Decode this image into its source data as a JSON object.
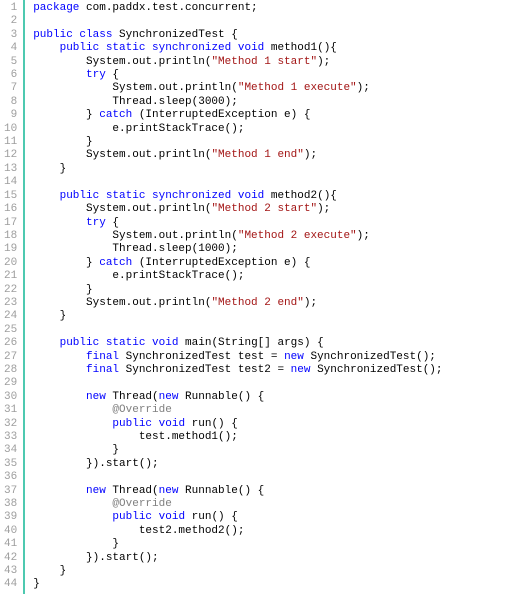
{
  "gutter": " 1\n 2\n 3\n 4\n 5\n 6\n 7\n 8\n 9\n10\n11\n12\n13\n14\n15\n16\n17\n18\n19\n20\n21\n22\n23\n24\n25\n26\n27\n28\n29\n30\n31\n32\n33\n34\n35\n36\n37\n38\n39\n40\n41\n42\n43\n44",
  "lines": [
    [
      {
        "cls": "kw",
        "t": "package"
      },
      {
        "cls": "",
        "t": " com.paddx.test.concurrent;"
      }
    ],
    [
      {
        "cls": "",
        "t": ""
      }
    ],
    [
      {
        "cls": "kw",
        "t": "public"
      },
      {
        "cls": "",
        "t": " "
      },
      {
        "cls": "kw",
        "t": "class"
      },
      {
        "cls": "",
        "t": " SynchronizedTest {"
      }
    ],
    [
      {
        "cls": "",
        "t": "    "
      },
      {
        "cls": "kw",
        "t": "public"
      },
      {
        "cls": "",
        "t": " "
      },
      {
        "cls": "kw",
        "t": "static"
      },
      {
        "cls": "",
        "t": " "
      },
      {
        "cls": "kw",
        "t": "synchronized"
      },
      {
        "cls": "",
        "t": " "
      },
      {
        "cls": "kw",
        "t": "void"
      },
      {
        "cls": "",
        "t": " method1(){"
      }
    ],
    [
      {
        "cls": "",
        "t": "        System.out.println("
      },
      {
        "cls": "str",
        "t": "\"Method 1 start\""
      },
      {
        "cls": "",
        "t": ");"
      }
    ],
    [
      {
        "cls": "",
        "t": "        "
      },
      {
        "cls": "kw",
        "t": "try"
      },
      {
        "cls": "",
        "t": " {"
      }
    ],
    [
      {
        "cls": "",
        "t": "            System.out.println("
      },
      {
        "cls": "str",
        "t": "\"Method 1 execute\""
      },
      {
        "cls": "",
        "t": ");"
      }
    ],
    [
      {
        "cls": "",
        "t": "            Thread.sleep(3000);"
      }
    ],
    [
      {
        "cls": "",
        "t": "        } "
      },
      {
        "cls": "kw",
        "t": "catch"
      },
      {
        "cls": "",
        "t": " (InterruptedException e) {"
      }
    ],
    [
      {
        "cls": "",
        "t": "            e.printStackTrace();"
      }
    ],
    [
      {
        "cls": "",
        "t": "        }"
      }
    ],
    [
      {
        "cls": "",
        "t": "        System.out.println("
      },
      {
        "cls": "str",
        "t": "\"Method 1 end\""
      },
      {
        "cls": "",
        "t": ");"
      }
    ],
    [
      {
        "cls": "",
        "t": "    }"
      }
    ],
    [
      {
        "cls": "",
        "t": ""
      }
    ],
    [
      {
        "cls": "",
        "t": "    "
      },
      {
        "cls": "kw",
        "t": "public"
      },
      {
        "cls": "",
        "t": " "
      },
      {
        "cls": "kw",
        "t": "static"
      },
      {
        "cls": "",
        "t": " "
      },
      {
        "cls": "kw",
        "t": "synchronized"
      },
      {
        "cls": "",
        "t": " "
      },
      {
        "cls": "kw",
        "t": "void"
      },
      {
        "cls": "",
        "t": " method2(){"
      }
    ],
    [
      {
        "cls": "",
        "t": "        System.out.println("
      },
      {
        "cls": "str",
        "t": "\"Method 2 start\""
      },
      {
        "cls": "",
        "t": ");"
      }
    ],
    [
      {
        "cls": "",
        "t": "        "
      },
      {
        "cls": "kw",
        "t": "try"
      },
      {
        "cls": "",
        "t": " {"
      }
    ],
    [
      {
        "cls": "",
        "t": "            System.out.println("
      },
      {
        "cls": "str",
        "t": "\"Method 2 execute\""
      },
      {
        "cls": "",
        "t": ");"
      }
    ],
    [
      {
        "cls": "",
        "t": "            Thread.sleep(1000);"
      }
    ],
    [
      {
        "cls": "",
        "t": "        } "
      },
      {
        "cls": "kw",
        "t": "catch"
      },
      {
        "cls": "",
        "t": " (InterruptedException e) {"
      }
    ],
    [
      {
        "cls": "",
        "t": "            e.printStackTrace();"
      }
    ],
    [
      {
        "cls": "",
        "t": "        }"
      }
    ],
    [
      {
        "cls": "",
        "t": "        System.out.println("
      },
      {
        "cls": "str",
        "t": "\"Method 2 end\""
      },
      {
        "cls": "",
        "t": ");"
      }
    ],
    [
      {
        "cls": "",
        "t": "    }"
      }
    ],
    [
      {
        "cls": "",
        "t": ""
      }
    ],
    [
      {
        "cls": "",
        "t": "    "
      },
      {
        "cls": "kw",
        "t": "public"
      },
      {
        "cls": "",
        "t": " "
      },
      {
        "cls": "kw",
        "t": "static"
      },
      {
        "cls": "",
        "t": " "
      },
      {
        "cls": "kw",
        "t": "void"
      },
      {
        "cls": "",
        "t": " main(String[] args) {"
      }
    ],
    [
      {
        "cls": "",
        "t": "        "
      },
      {
        "cls": "kw",
        "t": "final"
      },
      {
        "cls": "",
        "t": " SynchronizedTest test = "
      },
      {
        "cls": "kw",
        "t": "new"
      },
      {
        "cls": "",
        "t": " SynchronizedTest();"
      }
    ],
    [
      {
        "cls": "",
        "t": "        "
      },
      {
        "cls": "kw",
        "t": "final"
      },
      {
        "cls": "",
        "t": " SynchronizedTest test2 = "
      },
      {
        "cls": "kw",
        "t": "new"
      },
      {
        "cls": "",
        "t": " SynchronizedTest();"
      }
    ],
    [
      {
        "cls": "",
        "t": ""
      }
    ],
    [
      {
        "cls": "",
        "t": "        "
      },
      {
        "cls": "kw",
        "t": "new"
      },
      {
        "cls": "",
        "t": " Thread("
      },
      {
        "cls": "kw",
        "t": "new"
      },
      {
        "cls": "",
        "t": " Runnable() {"
      }
    ],
    [
      {
        "cls": "",
        "t": "            "
      },
      {
        "cls": "ann",
        "t": "@Override"
      }
    ],
    [
      {
        "cls": "",
        "t": "            "
      },
      {
        "cls": "kw",
        "t": "public"
      },
      {
        "cls": "",
        "t": " "
      },
      {
        "cls": "kw",
        "t": "void"
      },
      {
        "cls": "",
        "t": " run() {"
      }
    ],
    [
      {
        "cls": "",
        "t": "                test.method1();"
      }
    ],
    [
      {
        "cls": "",
        "t": "            }"
      }
    ],
    [
      {
        "cls": "",
        "t": "        }).start();"
      }
    ],
    [
      {
        "cls": "",
        "t": ""
      }
    ],
    [
      {
        "cls": "",
        "t": "        "
      },
      {
        "cls": "kw",
        "t": "new"
      },
      {
        "cls": "",
        "t": " Thread("
      },
      {
        "cls": "kw",
        "t": "new"
      },
      {
        "cls": "",
        "t": " Runnable() {"
      }
    ],
    [
      {
        "cls": "",
        "t": "            "
      },
      {
        "cls": "ann",
        "t": "@Override"
      }
    ],
    [
      {
        "cls": "",
        "t": "            "
      },
      {
        "cls": "kw",
        "t": "public"
      },
      {
        "cls": "",
        "t": " "
      },
      {
        "cls": "kw",
        "t": "void"
      },
      {
        "cls": "",
        "t": " run() {"
      }
    ],
    [
      {
        "cls": "",
        "t": "                test2.method2();"
      }
    ],
    [
      {
        "cls": "",
        "t": "            }"
      }
    ],
    [
      {
        "cls": "",
        "t": "        }).start();"
      }
    ],
    [
      {
        "cls": "",
        "t": "    }"
      }
    ],
    [
      {
        "cls": "",
        "t": "}"
      }
    ]
  ]
}
